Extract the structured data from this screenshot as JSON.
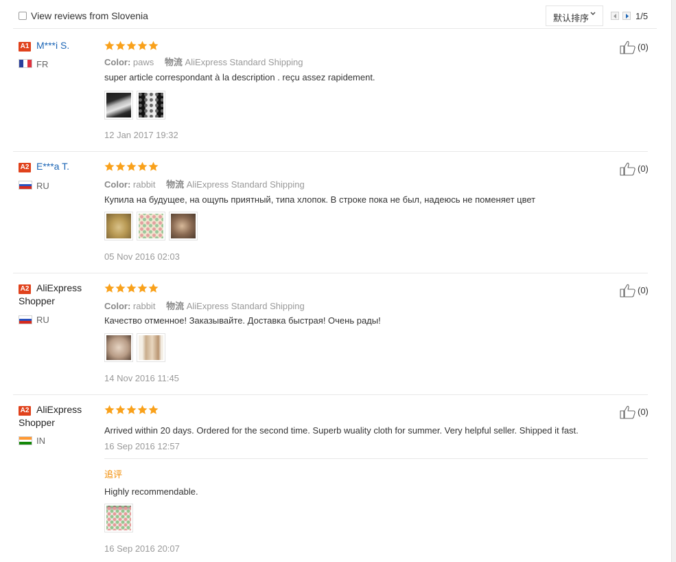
{
  "filter": {
    "label": "View reviews from Slovenia"
  },
  "sort": {
    "label": "默认排序",
    "chevron": "chevron-down-icon"
  },
  "pagination": {
    "text": "1/5"
  },
  "colors": {
    "badge": "#e0421c",
    "star": "#f9a11b",
    "username": "#1a64b5",
    "additional": "#f28b00"
  },
  "labels": {
    "color": "Color:",
    "logistics": "物流"
  },
  "reviews": [
    {
      "badge": "A1",
      "name": "M***i S.",
      "country": "FR",
      "rating": 5,
      "color": "paws",
      "shipping": "AliExpress Standard Shipping",
      "text": "super article correspondant à la description . reçu assez rapidement.",
      "date": "12 Jan 2017 19:32",
      "likes": "(0)",
      "photos": 2
    },
    {
      "badge": "A2",
      "name": "E***a T.",
      "country": "RU",
      "rating": 5,
      "color": "rabbit",
      "shipping": "AliExpress Standard Shipping",
      "text": "Купила на будущее, на ощупь приятный, типа хлопок. В строке пока не был, надеюсь не поменяет цвет",
      "date": "05 Nov 2016 02:03",
      "likes": "(0)",
      "photos": 3
    },
    {
      "badge": "A2",
      "name": "AliExpress Shopper",
      "name_line1": "AliExpress",
      "name_line2": "Shopper",
      "country": "RU",
      "rating": 5,
      "color": "rabbit",
      "shipping": "AliExpress Standard Shipping",
      "text": "Качество отменное! Заказывайте. Доставка быстрая! Очень рады!",
      "date": "14 Nov 2016 11:45",
      "likes": "(0)",
      "photos": 2
    },
    {
      "badge": "A2",
      "name": "AliExpress Shopper",
      "name_line1": "AliExpress",
      "name_line2": "Shopper",
      "country": "IN",
      "rating": 5,
      "text": "Arrived within 20 days. Ordered for the second time. Superb wuality cloth for summer. Very helpful seller. Shipped it fast.",
      "date": "16 Sep 2016 12:57",
      "likes": "(0)",
      "additional": {
        "label": "追评",
        "text": "Highly recommendable.",
        "date": "16 Sep 2016 20:07",
        "photos": 1
      }
    }
  ]
}
